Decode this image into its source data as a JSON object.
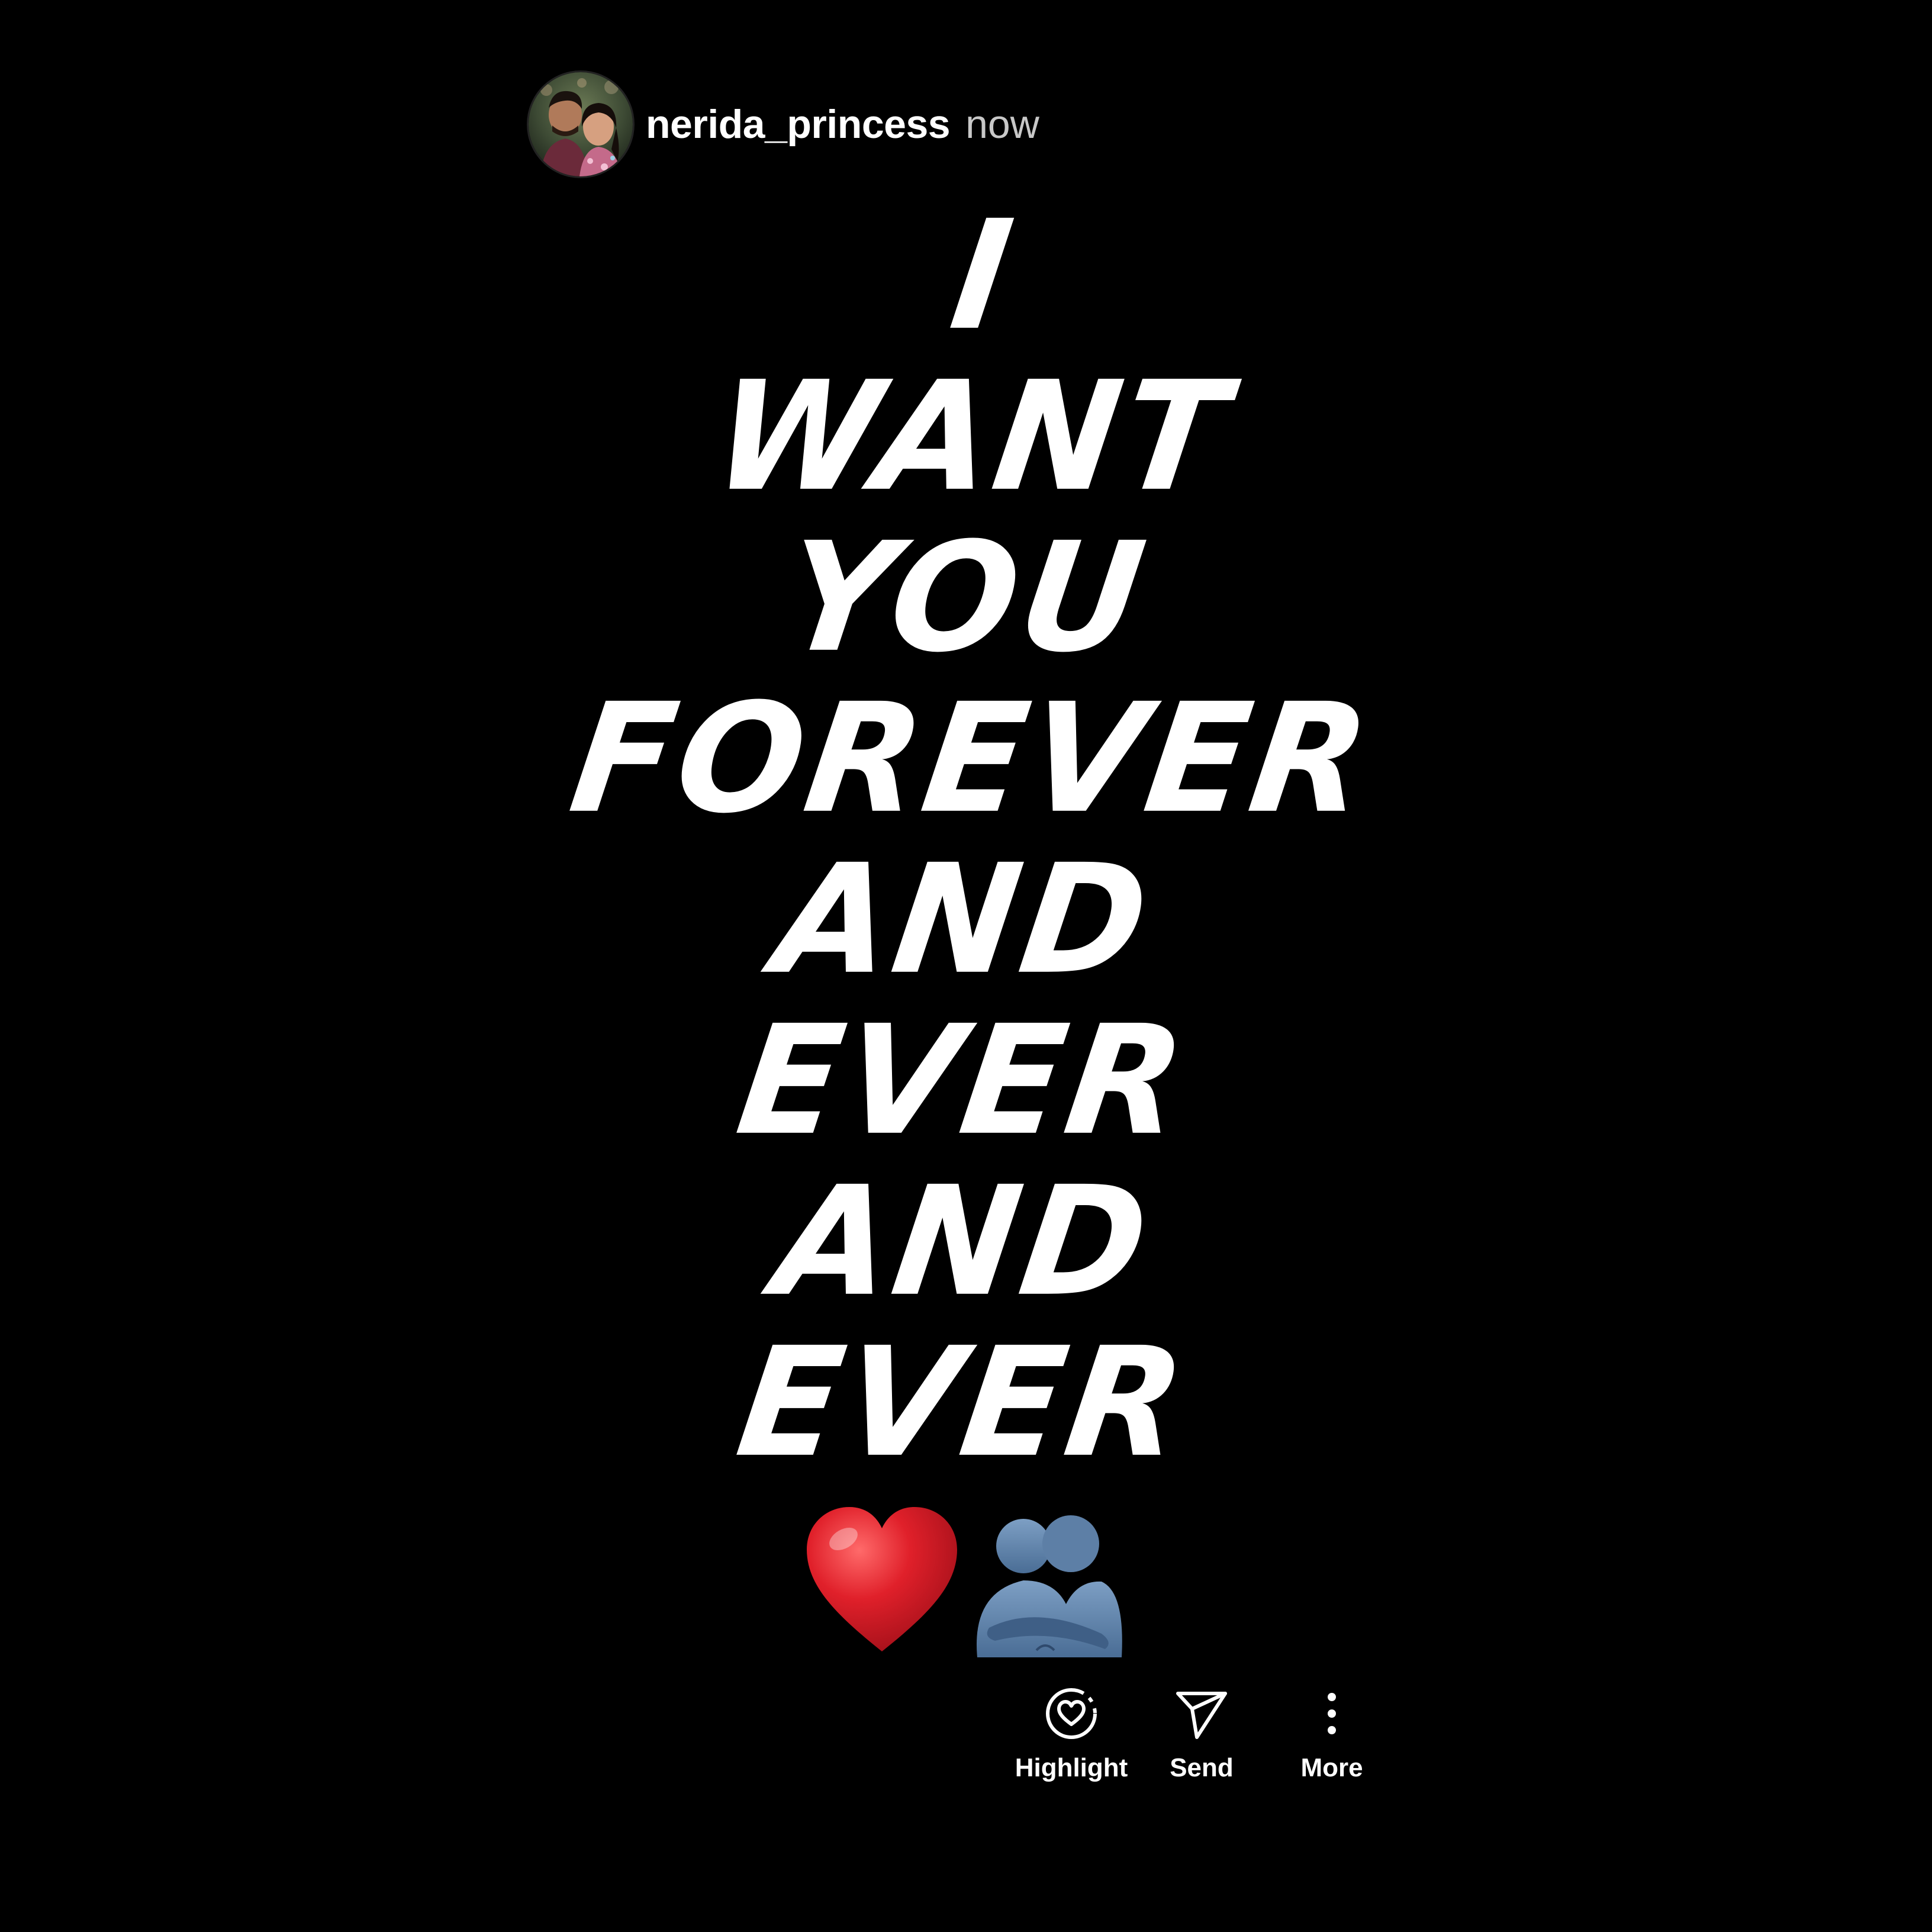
{
  "story": {
    "username": "nerida_princess",
    "timestamp": "now",
    "text_lines": [
      "I",
      "WANT",
      "YOU",
      "FOREVER",
      "AND",
      "EVER",
      "AND",
      "EVER"
    ],
    "emojis": [
      "red-heart-emoji",
      "people-hugging-emoji"
    ]
  },
  "actions": {
    "highlight_label": "Highlight",
    "send_label": "Send",
    "more_label": "More"
  },
  "colors": {
    "background": "#000000",
    "text": "#ffffff",
    "timestamp": "#c8c8c8",
    "heart": "#e0202a",
    "hug": "#5a7fa8"
  }
}
